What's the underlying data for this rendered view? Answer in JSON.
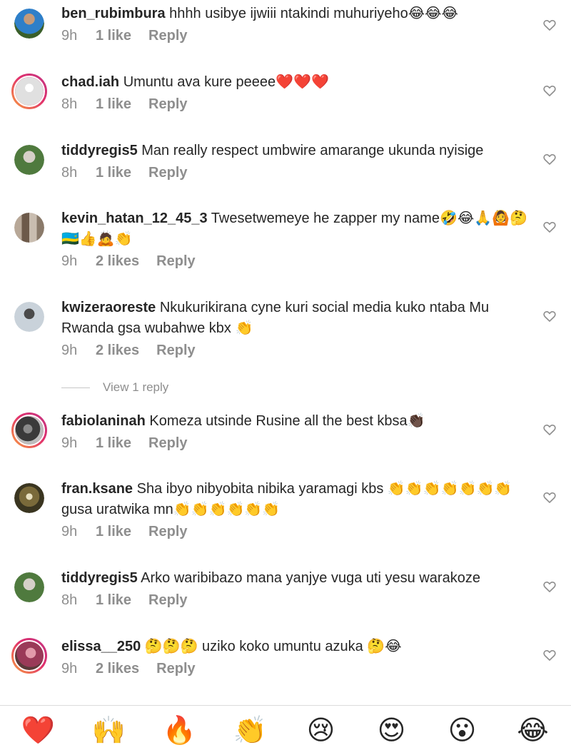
{
  "comments": [
    {
      "username": "ben_rubimbura",
      "text": "hhhh usibye ijwiii ntakindi muhuriyeho😂😂😂",
      "time": "9h",
      "likes": "1 like",
      "reply": "Reply",
      "avatar_color": "#3f7bb8"
    },
    {
      "username": "chad.iah",
      "text": "Umuntu ava kure peeee❤️❤️❤️",
      "time": "8h",
      "likes": "1 like",
      "reply": "Reply",
      "avatar_color": "#e6e6e6"
    },
    {
      "username": "tiddyregis5",
      "text": "Man really respect umbwire amarange ukunda nyisige",
      "time": "8h",
      "likes": "1 like",
      "reply": "Reply",
      "avatar_color": "#6b8a5a"
    },
    {
      "username": "kevin_hatan_12_45_3",
      "text": "Twesetwemeye he zapper my name🤣😂🙏🙆🤔🇷🇼👍🙇👏",
      "time": "9h",
      "likes": "2 likes",
      "reply": "Reply",
      "avatar_color": "#a89a8c"
    },
    {
      "username": "kwizeraoreste",
      "text": "Nkukurikirana cyne kuri social media  kuko ntaba Mu Rwanda gsa wubahwe kbx 👏",
      "time": "9h",
      "likes": "2 likes",
      "reply": "Reply",
      "avatar_color": "#b9c3cc"
    },
    {
      "username": "fabiolaninah",
      "text": "Komeza utsinde Rusine all the best kbsa👏🏿",
      "time": "9h",
      "likes": "1 like",
      "reply": "Reply",
      "avatar_color": "#5a5a5a"
    },
    {
      "username": "fran.ksane",
      "text": "Sha ibyo nibyobita nibika yaramagi kbs 👏👏👏👏👏👏👏gusa uratwika mn👏👏👏👏👏👏",
      "time": "9h",
      "likes": "1 like",
      "reply": "Reply",
      "avatar_color": "#5c5232"
    },
    {
      "username": "tiddyregis5",
      "text": "Arko waribibazo mana yanjye vuga uti yesu warakoze",
      "time": "8h",
      "likes": "1 like",
      "reply": "Reply",
      "avatar_color": "#6b8a5a"
    },
    {
      "username": "elissa__250",
      "text": "🤔🤔🤔 uziko koko umuntu azuka 🤔😂",
      "time": "9h",
      "likes": "2 likes",
      "reply": "Reply",
      "avatar_color": "#b04a6a"
    }
  ],
  "view_replies": "View 1 reply",
  "reactions": [
    "❤️",
    "🙌",
    "🔥",
    "👏",
    "😢",
    "😍",
    "😮",
    "😂"
  ],
  "colors": {
    "text": "#262626",
    "meta": "#8e8e8e",
    "heart_outline": "#8e8e8e"
  },
  "icons": {
    "like": "heart-outline-icon"
  }
}
